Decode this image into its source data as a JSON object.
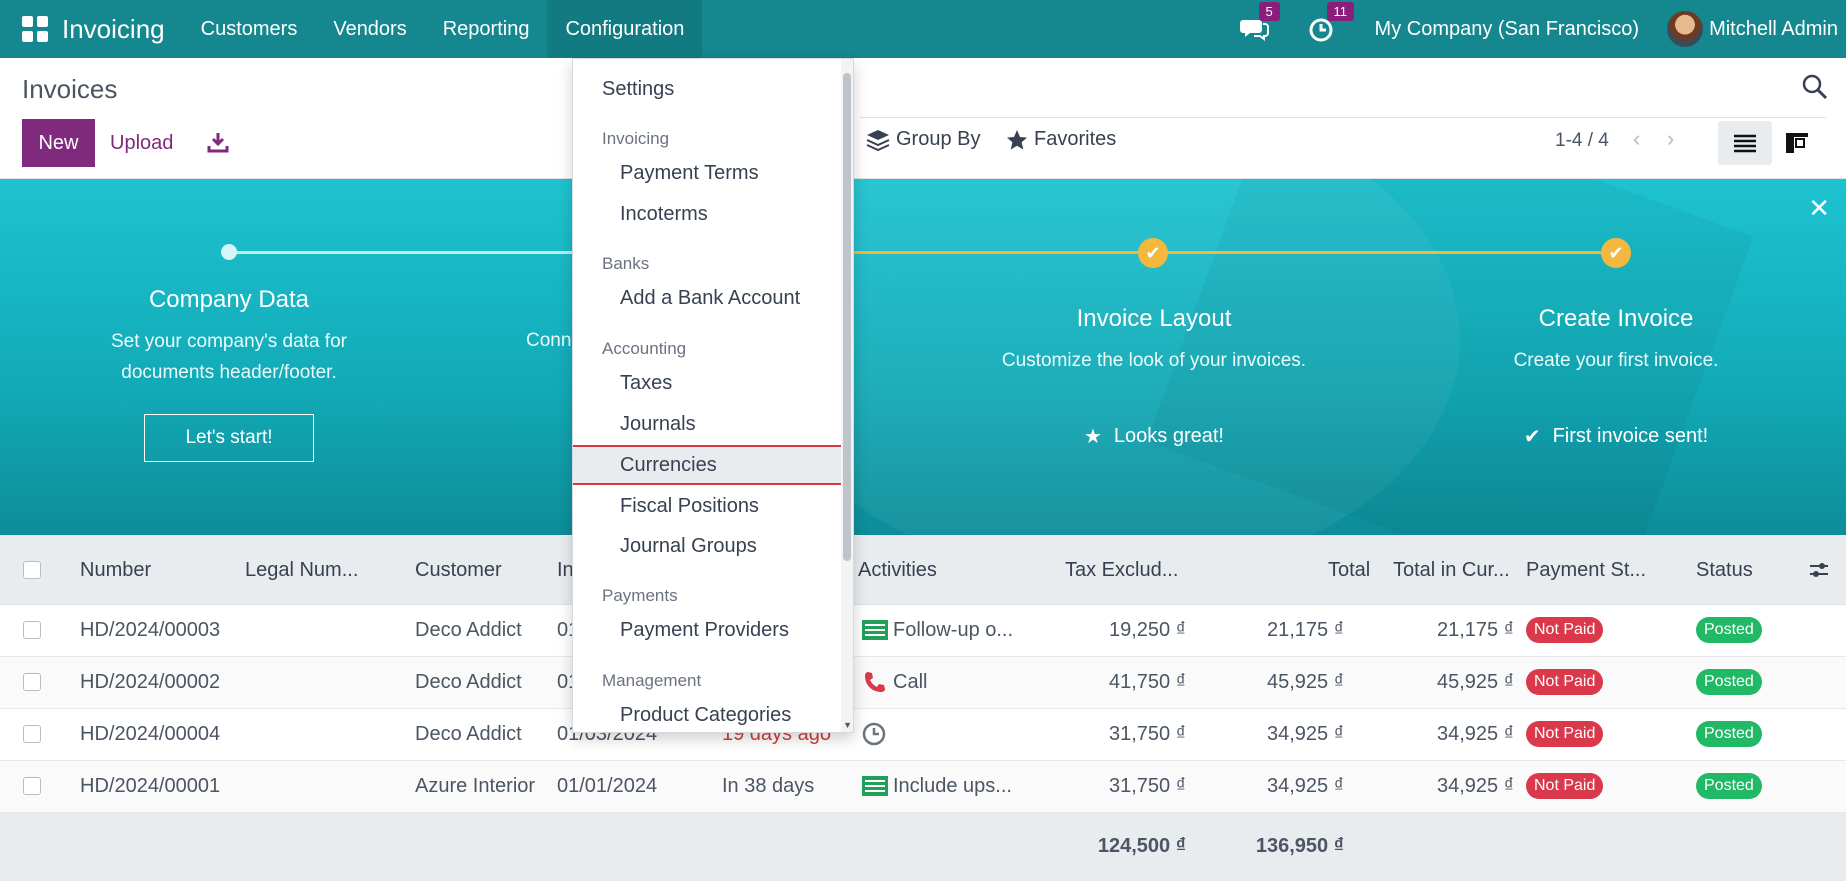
{
  "navbar": {
    "brand": "Invoicing",
    "menu": [
      "Customers",
      "Vendors",
      "Reporting",
      "Configuration"
    ],
    "messages_badge": "5",
    "activities_badge": "11",
    "company": "My Company (San Francisco)",
    "user": "Mitchell Admin"
  },
  "control": {
    "title": "Invoices",
    "new_label": "New",
    "upload_label": "Upload",
    "group_by_label": "Group By",
    "favorites_label": "Favorites",
    "pager": "1-4 / 4"
  },
  "banner": {
    "steps": [
      {
        "title": "Company Data",
        "desc1": "Set your company's data for",
        "desc2": "documents header/footer.",
        "button": "Let's start!"
      },
      {
        "title": "Conn",
        "desc1": "",
        "desc2": "",
        "button": ""
      },
      {
        "title": "Invoice Layout",
        "desc1": "Customize the look of your invoices.",
        "done": "Looks great!"
      },
      {
        "title": "Create Invoice",
        "desc1": "Create your first invoice.",
        "done": "First invoice sent!"
      }
    ]
  },
  "dropdown": {
    "settings": "Settings",
    "groups": [
      {
        "header": "Invoicing",
        "items": [
          "Payment Terms",
          "Incoterms"
        ]
      },
      {
        "header": "Banks",
        "items": [
          "Add a Bank Account"
        ]
      },
      {
        "header": "Accounting",
        "items": [
          "Taxes",
          "Journals",
          "Currencies",
          "Fiscal Positions",
          "Journal Groups"
        ]
      },
      {
        "header": "Payments",
        "items": [
          "Payment Providers"
        ]
      },
      {
        "header": "Management",
        "items": [
          "Product Categories"
        ]
      }
    ],
    "highlighted": "Currencies"
  },
  "table": {
    "columns": [
      "Number",
      "Legal Num...",
      "Customer",
      "In",
      "Activities",
      "Tax Exclud...",
      "Total",
      "Total in Cur...",
      "Payment St...",
      "Status"
    ],
    "rows": [
      {
        "number": "HD/2024/00003",
        "customer": "Deco Addict",
        "date": "01",
        "due": "",
        "activity": "Follow-up o...",
        "activity_icon": "task-icon",
        "tax_excl": "19,250 ₫",
        "total": "21,175 ₫",
        "total_cur": "21,175 ₫",
        "payment": "Not Paid",
        "status": "Posted"
      },
      {
        "number": "HD/2024/00002",
        "customer": "Deco Addict",
        "date": "01",
        "due": "",
        "activity": "Call",
        "activity_icon": "phone-icon",
        "tax_excl": "41,750 ₫",
        "total": "45,925 ₫",
        "total_cur": "45,925 ₫",
        "payment": "Not Paid",
        "status": "Posted"
      },
      {
        "number": "HD/2024/00004",
        "customer": "Deco Addict",
        "date": "01/03/2024",
        "due": "19 days ago",
        "activity": "",
        "activity_icon": "clock-icon",
        "tax_excl": "31,750 ₫",
        "total": "34,925 ₫",
        "total_cur": "34,925 ₫",
        "payment": "Not Paid",
        "status": "Posted"
      },
      {
        "number": "HD/2024/00001",
        "customer": "Azure Interior",
        "date": "01/01/2024",
        "due": "In 38 days",
        "activity": "Include ups...",
        "activity_icon": "task-icon",
        "tax_excl": "31,750 ₫",
        "total": "34,925 ₫",
        "total_cur": "34,925 ₫",
        "payment": "Not Paid",
        "status": "Posted"
      }
    ],
    "totals": {
      "tax_excl": "124,500 ₫",
      "total": "136,950 ₫"
    }
  },
  "colors": {
    "navbar": "#14878f",
    "primary": "#7f2a7c",
    "not_paid": "#d9394b",
    "posted": "#21b866",
    "highlight_border": "#d63a3f"
  }
}
